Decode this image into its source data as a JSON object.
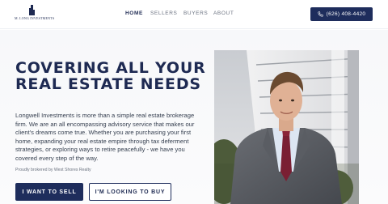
{
  "header": {
    "logo_text": "M. LONG INVESTMENTS",
    "nav": [
      {
        "label": "HOME",
        "active": true
      },
      {
        "label": "SELLERS",
        "active": false
      },
      {
        "label": "BUYERS",
        "active": false
      },
      {
        "label": "ABOUT",
        "active": false
      }
    ],
    "phone_icon": "phone-icon",
    "phone_label": "(626) 408-4420"
  },
  "hero": {
    "headline": "COVERING ALL YOUR REAL ESTATE NEEDS",
    "body": "Longwell Investments is more than a simple real estate brokerage firm. We are an all encompassing advisory service that makes our client's dreams come true. Whether you are purchasing your first home, expanding your real estate empire through tax deferment strategies, or exploring ways to retire peacefully - we have you covered every step of the way.",
    "brokered": "Proudly brokered by West Shores Realty",
    "sell_button": "I WANT TO SELL",
    "buy_button": "I'M LOOKING TO BUY"
  },
  "colors": {
    "navy": "#1e2d5c",
    "headline": "#1e2a52"
  }
}
